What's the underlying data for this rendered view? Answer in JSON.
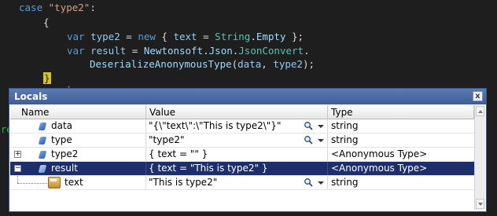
{
  "editor": {
    "case_kw": "case",
    "case_str": "\"type2\"",
    "case_colon": ":",
    "open_brace": "{",
    "line3": {
      "var": "var",
      "name": "type2",
      "eq": " = ",
      "new": "new",
      "open": " { ",
      "prop": "text",
      "eq2": " = ",
      "cls": "String",
      "dot": ".",
      "member": "Empty",
      "close": " };"
    },
    "line4": {
      "var": "var",
      "name": "result",
      "eq": " = ",
      "ns1": "Newtonsoft",
      "dot1": ".",
      "ns2": "Json",
      "dot2": ".",
      "cls": "JsonConvert",
      "dot3": "."
    },
    "line5": {
      "method": "DeserializeAnonymousType",
      "open": "(",
      "arg1": "data",
      "comma": ", ",
      "arg2": "type2",
      "close": ");"
    },
    "close_brace": "}",
    "gutter_fragment": "re",
    "tick_fragment": "·"
  },
  "locals": {
    "title": "Locals",
    "close_label": "x",
    "columns": [
      "Name",
      "Value",
      "Type"
    ],
    "rows": [
      {
        "name": "data",
        "value": "\"{\\\"text\\\":\\\"This is type2\\\"}\"",
        "type": "string",
        "selected": false
      },
      {
        "name": "type",
        "value": "\"type2\"",
        "type": "string",
        "selected": false
      },
      {
        "name": "type2",
        "value": "{ text = \"\" }",
        "type": "<Anonymous Type>",
        "selected": false,
        "expander": "+"
      },
      {
        "name": "result",
        "value": "{ text = \"This is type2\" }",
        "type": "<Anonymous Type>",
        "selected": true,
        "expander": "−"
      },
      {
        "name": "text",
        "value": "\"This is type2\"",
        "type": "string",
        "selected": false
      }
    ],
    "icons": {
      "variable": "variable-icon",
      "property": "property-icon",
      "magnifier": "magnifier-icon",
      "dropdown": "dropdown-arrow-icon"
    },
    "colors": {
      "title_bar": "#4a6aa5",
      "selection": "#1c2f6b"
    }
  }
}
